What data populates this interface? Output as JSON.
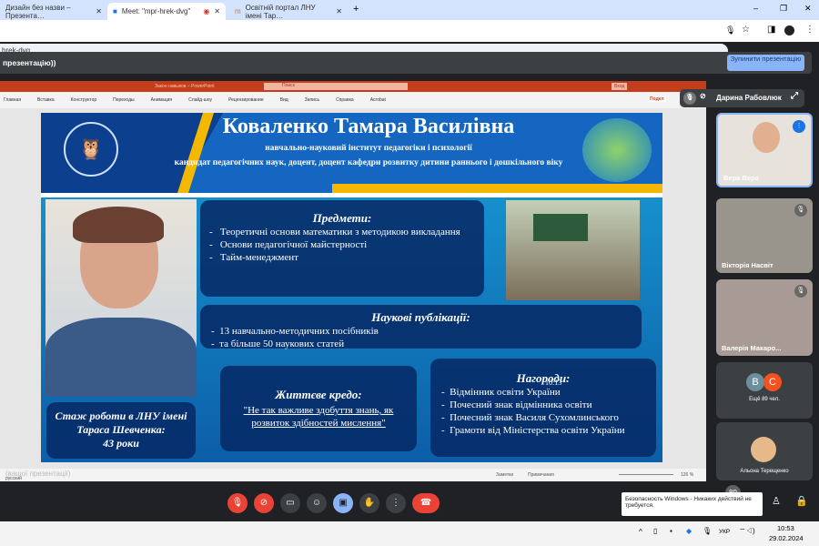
{
  "browser": {
    "tabs": [
      {
        "label": "Дизайн без назви – Презента…"
      },
      {
        "label": "Meet: \"mpr-hrek-dvg\""
      },
      {
        "label": "Освітній портал ЛНУ імені Тар…"
      }
    ],
    "url": "hrek-dvg"
  },
  "meet": {
    "banner": "презентацію))",
    "stop_button": "Зупинити презентацію",
    "pinned_name": "Дарина Рабовлюк",
    "participants": [
      {
        "name": "Вера Вера"
      },
      {
        "name": "Вікторія Насвіт"
      },
      {
        "name": "Валерія Макаро..."
      },
      {
        "name": "Альона Терещенко"
      }
    ],
    "others_label": "Ещё 89 чел.",
    "others_avatars": [
      "В",
      "С"
    ],
    "count_badge": "89",
    "notification": "Безопасность Windows - Никаких действий не требуется."
  },
  "ppt": {
    "title": "Закон навыков – PowerPoint",
    "search": "Поиск",
    "signin": "Вход",
    "share": "Подел",
    "ribbon": [
      "Главная",
      "Вставка",
      "Конструктор",
      "Переходы",
      "Анимация",
      "Слайд-шоу",
      "Рецензирование",
      "Вид",
      "Запись",
      "Справка",
      "Acrobat"
    ],
    "status_lang": "русский",
    "status_notes": "Заметки",
    "status_comments": "Примечания",
    "zoom": "126 %",
    "slide_caption": "(вашої презентації)"
  },
  "slide": {
    "name": "Коваленко Тамара Василівна",
    "institute": "навчально-науковий інститут педагогіки і психології",
    "position": "кандидат педагогічних наук, доцент, доцент кафедри розвитку дитини раннього і дошкільного віку",
    "subjects_title": "Предмети:",
    "subjects": [
      "Теоретичні основи математики з методикою викладання",
      "Основи педагогічної майстерності",
      "Тайм-менеджмент"
    ],
    "pubs_title": "Наукові публікації:",
    "pubs": [
      "13 навчально-методичних посібників",
      "та більше 50 наукових статей"
    ],
    "credo_title": "Життєве кредо:",
    "credo": "\"Не так важливе здобуття знань, як розвиток здібностей мислення\"",
    "awards_title": "Нагороди:",
    "awards": [
      "Відмінник освіти України",
      "Почесний знак відмінника освіти",
      "Почесний знак Василя Сухомлинського",
      "Грамоти від Міністерства освіти України"
    ],
    "tenure": "Стаж роботи в ЛНУ імені Тараса Шевченка:",
    "tenure_years": "43 роки",
    "timestamp": "10:13"
  },
  "taskbar": {
    "lang": "УКР",
    "time": "10:53",
    "date": "29.02.2024"
  }
}
